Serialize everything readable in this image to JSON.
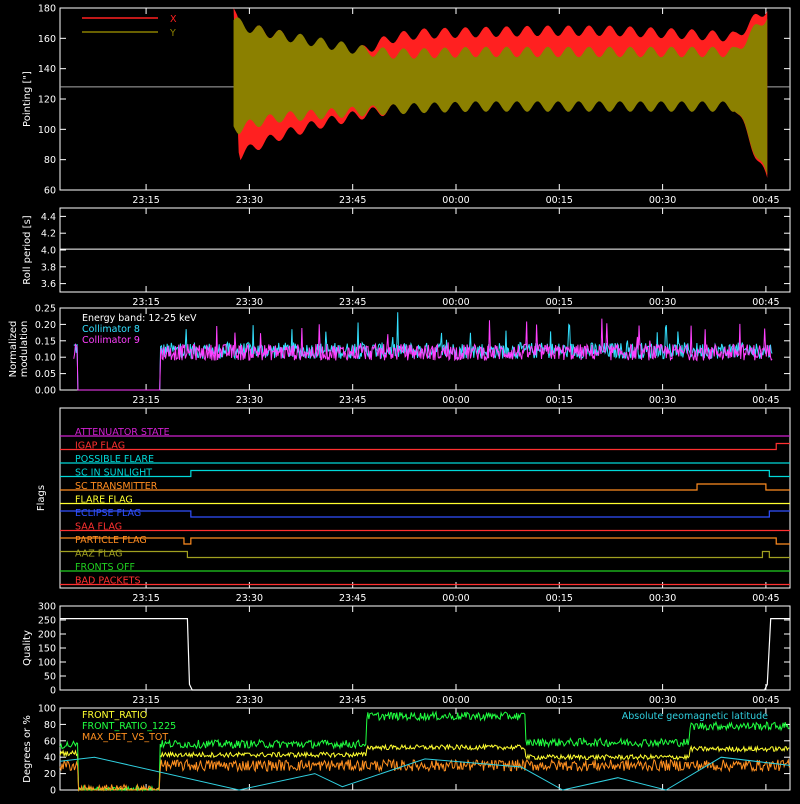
{
  "time_ticks": [
    "23:15",
    "23:30",
    "23:45",
    "00:00",
    "00:15",
    "00:30",
    "00:45"
  ],
  "time_tick_minutes": [
    12.5,
    27.5,
    42.5,
    57.5,
    72.5,
    87.5,
    102.5
  ],
  "x_range_minutes": [
    0,
    106
  ],
  "chart_data": [
    {
      "id": "pointing",
      "type": "area",
      "ylabel": "Pointing [\"]",
      "ylim": [
        60,
        180
      ],
      "yticks": [
        60,
        80,
        100,
        120,
        140,
        160,
        180
      ],
      "reference_line": 128,
      "series": [
        {
          "name": "X",
          "color": "#ff2020",
          "x": [
            25.2,
            26,
            28,
            32,
            38,
            44,
            48,
            52,
            60,
            70,
            80,
            90,
            98,
            102.7
          ],
          "upper": [
            180,
            168,
            166,
            162,
            156,
            152,
            160,
            163,
            164,
            165,
            165,
            163,
            161,
            180
          ],
          "lower": [
            180,
            82,
            88,
            96,
            104,
            110,
            113,
            115,
            116,
            116,
            116,
            116,
            115,
            66
          ]
        },
        {
          "name": "Y",
          "color": "#8b8000",
          "x": [
            25.2,
            26,
            28,
            32,
            38,
            44,
            48,
            52,
            60,
            70,
            80,
            90,
            98,
            102.7
          ],
          "upper": [
            172,
            170,
            166,
            162,
            157,
            152,
            150,
            150,
            151,
            151,
            151,
            151,
            151,
            175
          ],
          "lower": [
            102,
            100,
            104,
            108,
            110,
            112,
            113,
            114,
            115,
            115,
            115,
            115,
            115,
            68
          ]
        }
      ]
    },
    {
      "id": "roll-period",
      "type": "line",
      "ylabel": "Roll period [s]",
      "ylim": [
        3.5,
        4.5
      ],
      "yticks": [
        3.6,
        3.8,
        4.0,
        4.2,
        4.4
      ],
      "series": [
        {
          "name": "",
          "color": "#ffffff",
          "x": [
            0,
            106
          ],
          "y": [
            4.01,
            4.01
          ]
        }
      ]
    },
    {
      "id": "modulation",
      "type": "line",
      "ylabel": "Normalized modulation",
      "ylim": [
        0,
        0.25
      ],
      "yticks": [
        0.0,
        0.05,
        0.1,
        0.15,
        0.2,
        0.25
      ],
      "annotation": "Energy band: 12-25 keV",
      "series": [
        {
          "name": "Collimator 8",
          "color": "#33e0ff",
          "x": [
            2,
            14.5,
            103.5
          ],
          "y": [
            0.13,
            0.12,
            0.12
          ]
        },
        {
          "name": "Collimator 9",
          "color": "#ff40ff",
          "x": [
            2,
            14.5,
            103.5
          ],
          "y": [
            0.12,
            0.115,
            0.115
          ]
        }
      ]
    },
    {
      "id": "flags",
      "type": "line",
      "ylabel": "Flags",
      "series": [
        {
          "name": "ATTENUATOR STATE",
          "color": "#d020d0",
          "x": [
            0,
            106
          ],
          "y": [
            0,
            0
          ]
        },
        {
          "name": "IGAP FLAG",
          "color": "#ff3030",
          "x": [
            0,
            14.5,
            14.5,
            104,
            104,
            106
          ],
          "y": [
            0,
            0,
            0,
            0,
            1,
            1
          ]
        },
        {
          "name": "POSSIBLE FLARE",
          "color": "#00d8d8",
          "x": [
            0,
            106
          ],
          "y": [
            0,
            0
          ]
        },
        {
          "name": "SC IN SUNLIGHT",
          "color": "#00d8d8",
          "x": [
            0,
            19,
            19,
            103,
            103,
            106
          ],
          "y": [
            0,
            0,
            1,
            1,
            0,
            0
          ]
        },
        {
          "name": "SC TRANSMITTER",
          "color": "#ff8c20",
          "x": [
            0,
            92.5,
            92.5,
            102.5,
            102.5,
            106
          ],
          "y": [
            0,
            0,
            1,
            1,
            0,
            0
          ]
        },
        {
          "name": "FLARE FLAG",
          "color": "#ffff30",
          "x": [
            0,
            106
          ],
          "y": [
            0,
            0
          ]
        },
        {
          "name": "ECLIPSE FLAG",
          "color": "#3050ff",
          "x": [
            0,
            19,
            19,
            103,
            103,
            106
          ],
          "y": [
            1,
            1,
            0,
            0,
            1,
            1
          ]
        },
        {
          "name": "SAA FLAG",
          "color": "#ff3030",
          "x": [
            0,
            106
          ],
          "y": [
            0,
            0
          ]
        },
        {
          "name": "PARTICLE FLAG",
          "color": "#ff8c20",
          "x": [
            0,
            18,
            18,
            19,
            19,
            104,
            104,
            106
          ],
          "y": [
            1,
            1,
            0,
            0,
            1,
            1,
            0,
            0
          ]
        },
        {
          "name": "AAZ FLAG",
          "color": "#a0a020",
          "x": [
            0,
            18.5,
            18.5,
            102,
            102,
            103,
            103,
            106
          ],
          "y": [
            1,
            1,
            0,
            0,
            1,
            1,
            0,
            0
          ]
        },
        {
          "name": "FRONTS OFF",
          "color": "#20d020",
          "x": [
            0,
            106
          ],
          "y": [
            0,
            0
          ]
        },
        {
          "name": "BAD PACKETS",
          "color": "#ff3030",
          "x": [
            0,
            106
          ],
          "y": [
            0,
            0
          ]
        }
      ]
    },
    {
      "id": "quality",
      "type": "line",
      "ylabel": "Quality",
      "ylim": [
        0,
        300
      ],
      "yticks": [
        0,
        50,
        100,
        150,
        200,
        250,
        300
      ],
      "series": [
        {
          "name": "",
          "color": "#ffffff",
          "x": [
            0,
            18.5,
            18.8,
            19.2,
            102.3,
            102.7,
            103.2,
            106
          ],
          "y": [
            255,
            255,
            20,
            0,
            0,
            20,
            255,
            255
          ]
        }
      ]
    },
    {
      "id": "geo",
      "type": "line",
      "ylabel": "Degrees or %",
      "ylim": [
        0,
        100
      ],
      "yticks": [
        0,
        20,
        40,
        60,
        80,
        100
      ],
      "series": [
        {
          "name": "FRONT_RATIO",
          "color": "#ffff30",
          "x": [
            0,
            14.5,
            44.5,
            67.5,
            91.5,
            106
          ],
          "y": [
            45,
            43,
            52,
            40,
            50,
            50
          ]
        },
        {
          "name": "FRONT_RATIO_1225",
          "color": "#20ff40",
          "x": [
            0,
            14.5,
            44.5,
            67.5,
            91.5,
            106
          ],
          "y": [
            55,
            56,
            90,
            58,
            78,
            78
          ]
        },
        {
          "name": "MAX_DET_VS_TOT",
          "color": "#ff9020",
          "x": [
            0,
            106
          ],
          "y": [
            30,
            30
          ]
        },
        {
          "name": "Absolute geomagnetic latitude",
          "color": "#30d0e0",
          "x": [
            0,
            5,
            26,
            37,
            41,
            53,
            67,
            73,
            81,
            88,
            96,
            106
          ],
          "y": [
            35,
            40,
            0,
            20,
            4,
            38,
            28,
            0,
            15,
            0,
            40,
            30
          ]
        }
      ]
    }
  ]
}
